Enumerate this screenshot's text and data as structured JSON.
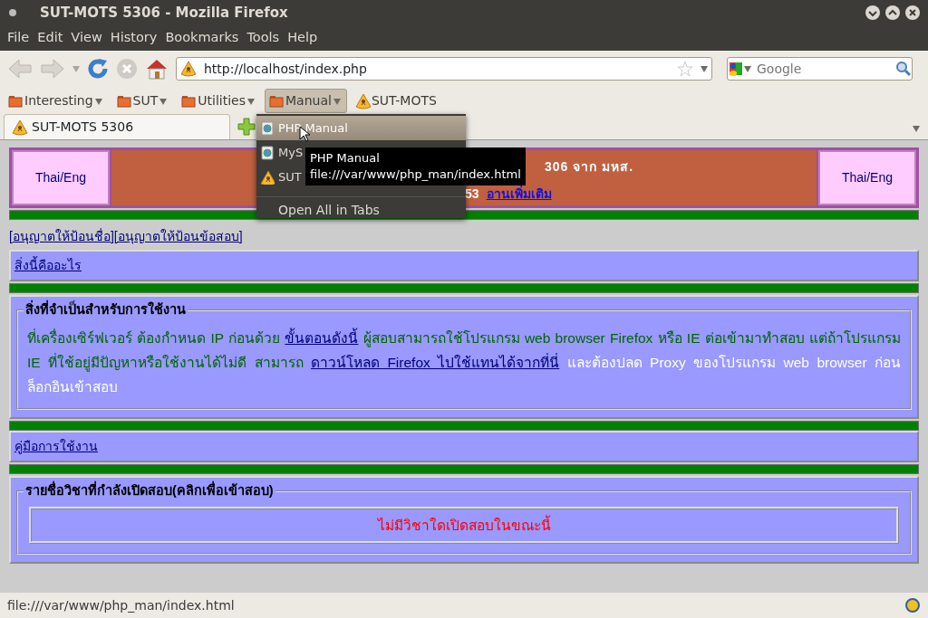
{
  "window": {
    "title": "SUT-MOTS 5306 - Mozilla Firefox"
  },
  "menu_bar": [
    "File",
    "Edit",
    "View",
    "History",
    "Bookmarks",
    "Tools",
    "Help"
  ],
  "nav": {
    "url": "http://localhost/index.php",
    "search_placeholder": "Google"
  },
  "bookmarks": [
    {
      "label": "Interesting",
      "kind": "folder",
      "open": false
    },
    {
      "label": "SUT",
      "kind": "folder",
      "open": false
    },
    {
      "label": "Utilities",
      "kind": "folder",
      "open": false
    },
    {
      "label": "Manual",
      "kind": "folder",
      "open": true
    },
    {
      "label": "SUT-MOTS",
      "kind": "site",
      "open": false
    }
  ],
  "tabs": [
    {
      "label": "SUT-MOTS 5306",
      "selected": true
    }
  ],
  "bookmark_menu": {
    "items": [
      {
        "label": "PHP Manual",
        "kind": "page",
        "selected": true
      },
      {
        "label": "MyS",
        "kind": "page",
        "selected": false
      },
      {
        "label": "SUT",
        "kind": "site",
        "selected": false
      }
    ],
    "footer": "Open All in Tabs"
  },
  "tooltip": {
    "title": "PHP Manual",
    "url": "file:///var/www/php_man/index.html"
  },
  "page": {
    "banner": {
      "left": "Thai/Eng",
      "right": "Thai/Eng",
      "line1": "306 จาก มหส.",
      "line2": "53",
      "line2_link": "อานเพิ่มเติม"
    },
    "top_links": [
      "[อนุญาตให้ป้อนชื่อ]",
      "[อนุญาตให้ป้อนข้อสอบ]"
    ],
    "sections": [
      {
        "kind": "link",
        "text": "สิ่งนี้คืออะไร"
      },
      {
        "kind": "fieldset",
        "legend": "สิ่งที่จำเป็นสำหรับการใช้งาน",
        "runs": [
          {
            "kind": "text",
            "text": "ที่เครื่องเซิร์ฟเวอร์ ต้องกำหนด IP ก่อนด้วย ",
            "color": "#006600"
          },
          {
            "kind": "link",
            "text": "ขั้นตอนดังนี้"
          },
          {
            "kind": "text",
            "text": " ผู้สอบสามารถใช้โปรแกรม web browser Firefox หรือ IE ต่อเข้ามาทำสอบ แต่ถ้าโปรแกรม IE ที่ใช้อยู่มีปัญหาหรือใช้งานได้ไม่ดี สามารถ ",
            "color": "#006600"
          },
          {
            "kind": "link",
            "text": "ดาวน์โหลด Firefox ไปใช้แทนได้จากที่นี่"
          },
          {
            "kind": "text",
            "text": " และต้องปลด Proxy ของโปรแกรม web browser ก่อนล็อกอินเข้าสอบ",
            "color": "#ffffff"
          }
        ]
      },
      {
        "kind": "link",
        "text": "คู่มือการใช้งาน"
      },
      {
        "kind": "fieldset",
        "legend": "รายชื่อวิชาที่กำลังเปิดสอบ(คลิกเพื่อเข้าสอบ)",
        "message": "ไม่มีวิชาใดเปิดสอบในขณะนี้"
      }
    ]
  },
  "status_bar": "file:///var/www/php_man/index.html"
}
